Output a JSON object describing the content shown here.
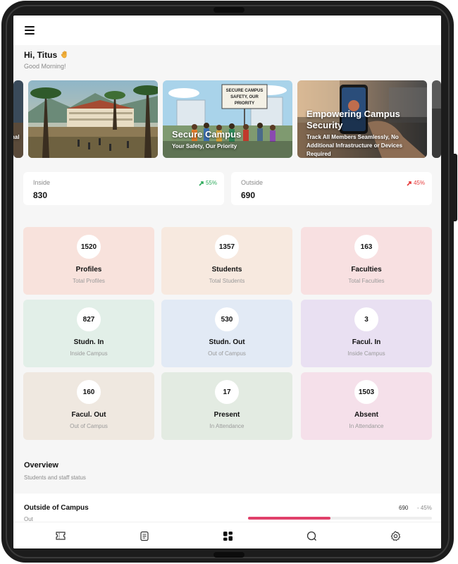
{
  "greeting": {
    "title": "Hi, Titus",
    "wave_icon": "waving-hand-icon",
    "subtitle": "Good Morning!"
  },
  "banners": [
    {
      "title": "",
      "subtitle": "nal"
    },
    {
      "title": "",
      "subtitle": ""
    },
    {
      "title": "Secure Campus",
      "subtitle": "Your Safety, Our Priority",
      "sign_text": "SECURE CAMPUS SAFETY OUR PRIORITY"
    },
    {
      "title": "Empowering Campus Security",
      "subtitle": "Track All Members Seamlessly, No Additional Infrastructure or Devices Required"
    },
    {
      "title": "",
      "subtitle": ""
    }
  ],
  "stats": {
    "inside": {
      "label": "Inside",
      "value": "830",
      "trend": "55%",
      "trend_icon": "trend-up-icon",
      "color": "#2eaa5c"
    },
    "outside": {
      "label": "Outside",
      "value": "690",
      "trend": "45%",
      "trend_icon": "trend-down-icon",
      "color": "#e63b3b"
    }
  },
  "tiles": [
    {
      "value": "1520",
      "title": "Profiles",
      "subtitle": "Total Profiles",
      "color": "#f8e2dc"
    },
    {
      "value": "1357",
      "title": "Students",
      "subtitle": "Total Students",
      "color": "#f7e9df"
    },
    {
      "value": "163",
      "title": "Faculties",
      "subtitle": "Total Faculties",
      "color": "#f8e0e1"
    },
    {
      "value": "827",
      "title": "Studn. In",
      "subtitle": "Inside Campus",
      "color": "#e2efe8"
    },
    {
      "value": "530",
      "title": "Studn. Out",
      "subtitle": "Out of Campus",
      "color": "#e2eaf5"
    },
    {
      "value": "3",
      "title": "Facul. In",
      "subtitle": "Inside Campus",
      "color": "#e9e0f2"
    },
    {
      "value": "160",
      "title": "Facul. Out",
      "subtitle": "Out of Campus",
      "color": "#efe8e0"
    },
    {
      "value": "17",
      "title": "Present",
      "subtitle": "In Attendance",
      "color": "#e3ebe2"
    },
    {
      "value": "1503",
      "title": "Absent",
      "subtitle": "In Attendance",
      "color": "#f5e0ea"
    }
  ],
  "overview": {
    "title": "Overview",
    "subtitle": "Students and staff status"
  },
  "progress": {
    "title": "Outside of Campus",
    "subtitle": "Out",
    "value": "690",
    "percent": "- 45%",
    "fraction": 0.45,
    "color": "#e0406a"
  },
  "nav": [
    {
      "name": "nav-ticket",
      "icon": "ticket-icon"
    },
    {
      "name": "nav-list",
      "icon": "list-icon"
    },
    {
      "name": "nav-dashboard",
      "icon": "dashboard-grid-icon",
      "active": true
    },
    {
      "name": "nav-search",
      "icon": "search-icon"
    },
    {
      "name": "nav-settings",
      "icon": "gear-icon"
    }
  ]
}
